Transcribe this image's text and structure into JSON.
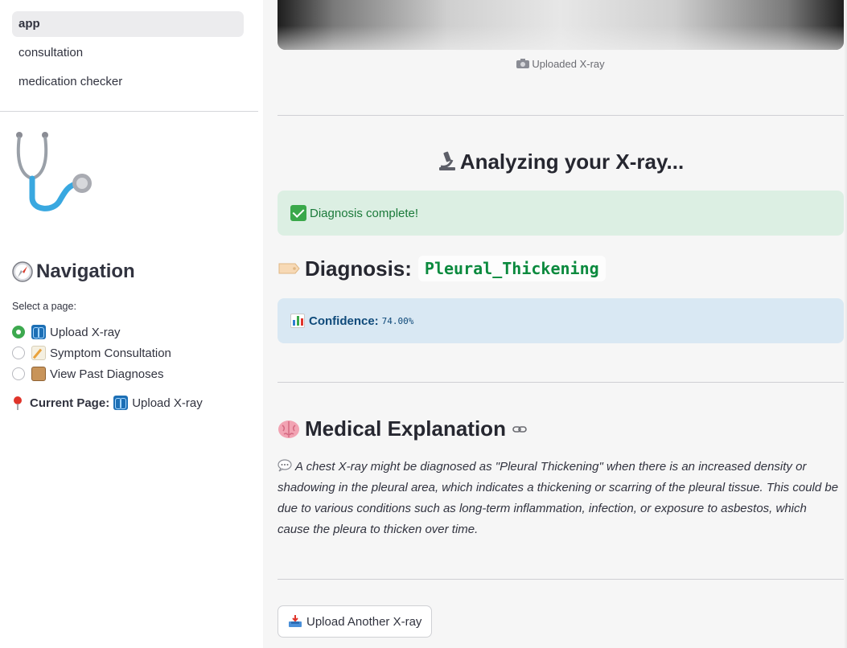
{
  "sidebar": {
    "pages": [
      {
        "label": "app",
        "active": true
      },
      {
        "label": "consultation",
        "active": false
      },
      {
        "label": "medication checker",
        "active": false
      }
    ],
    "navigation_title": "Navigation",
    "select_label": "Select a page:",
    "radio_options": [
      {
        "label": "Upload X-ray",
        "icon": "xray-emoji",
        "checked": true
      },
      {
        "label": "Symptom Consultation",
        "icon": "memo-emoji",
        "checked": false
      },
      {
        "label": "View Past Diagnoses",
        "icon": "scroll-emoji",
        "checked": false
      }
    ],
    "current_page_label": "Current Page:",
    "current_page_value": "Upload X-ray"
  },
  "main": {
    "image_caption": "Uploaded X-ray",
    "analyzing_heading": "Analyzing your X-ray...",
    "success_message": "Diagnosis complete!",
    "diagnosis_label": "Diagnosis:",
    "diagnosis_value": "Pleural_Thickening",
    "confidence_label": "Confidence:",
    "confidence_value": "74.00%",
    "explanation_heading": "Medical Explanation",
    "explanation_text": "A chest X-ray might be diagnosed as \"Pleural Thickening\" when there is an increased density or shadowing in the pleural area, which indicates a thickening or scarring of the pleural tissue. This could be due to various conditions such as long-term inflammation, infection, or exposure to asbestos, which cause the pleura to thicken over time.",
    "upload_button": "Upload Another X-ray"
  },
  "colors": {
    "accent_green": "#3da94f",
    "success_bg": "#dcefe3",
    "info_bg": "#d9e8f3",
    "code_green": "#0b8a3e"
  }
}
